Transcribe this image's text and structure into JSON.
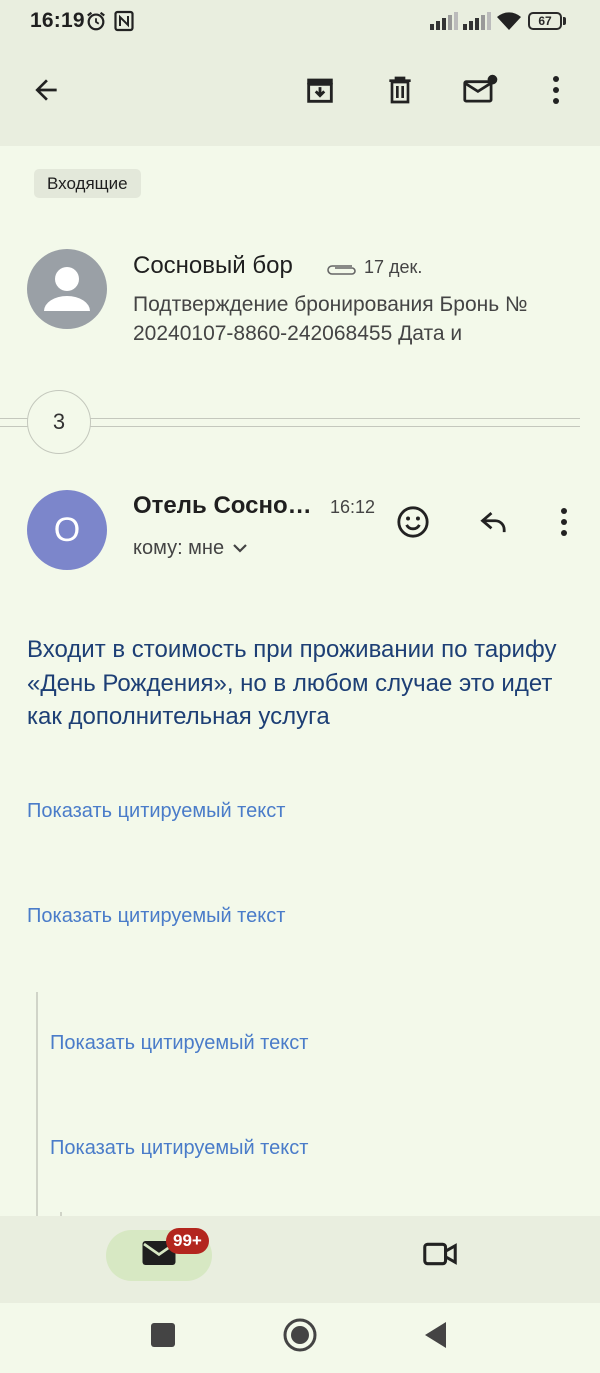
{
  "status_bar": {
    "time": "16:19",
    "battery": "67"
  },
  "label": "Входящие",
  "thread": [
    {
      "sender": "Сосновый бор",
      "date": "17 дек.",
      "snippet": "Подтверждение бронирования Бронь № 20240107-8860-242068455 Дата и"
    }
  ],
  "hidden_count": "3",
  "message": {
    "avatar_letter": "О",
    "sender": "Отель Сосно…",
    "time": "16:12",
    "recipient": "кому: мне",
    "body": "Входит в стоимость при проживании по тарифу «День Рождения», но в любом случае это идет как дополнительная услуга",
    "quoted_links": [
      "Показать цитируемый текст",
      "Показать цитируемый текст",
      "Показать цитируемый текст",
      "Показать цитируемый текст"
    ]
  },
  "bottom_nav": {
    "mail_badge": "99+"
  },
  "colors": {
    "background": "#f3f9ea",
    "bar": "#e9eedf",
    "link": "#4a7cc9",
    "body_text": "#1d3f75",
    "avatar_expanded": "#7c86cb",
    "badge": "#b3261e"
  },
  "icons": [
    "alarm-icon",
    "nfc-icon",
    "signal-icon",
    "wifi-icon",
    "battery-icon",
    "back-arrow-icon",
    "archive-icon",
    "trash-icon",
    "mark-unread-icon",
    "more-vert-icon",
    "attachment-icon",
    "person-icon",
    "chevron-down-icon",
    "emoji-icon",
    "reply-icon",
    "mail-icon",
    "video-icon",
    "square-icon",
    "home-circle-icon",
    "back-triangle-icon"
  ]
}
